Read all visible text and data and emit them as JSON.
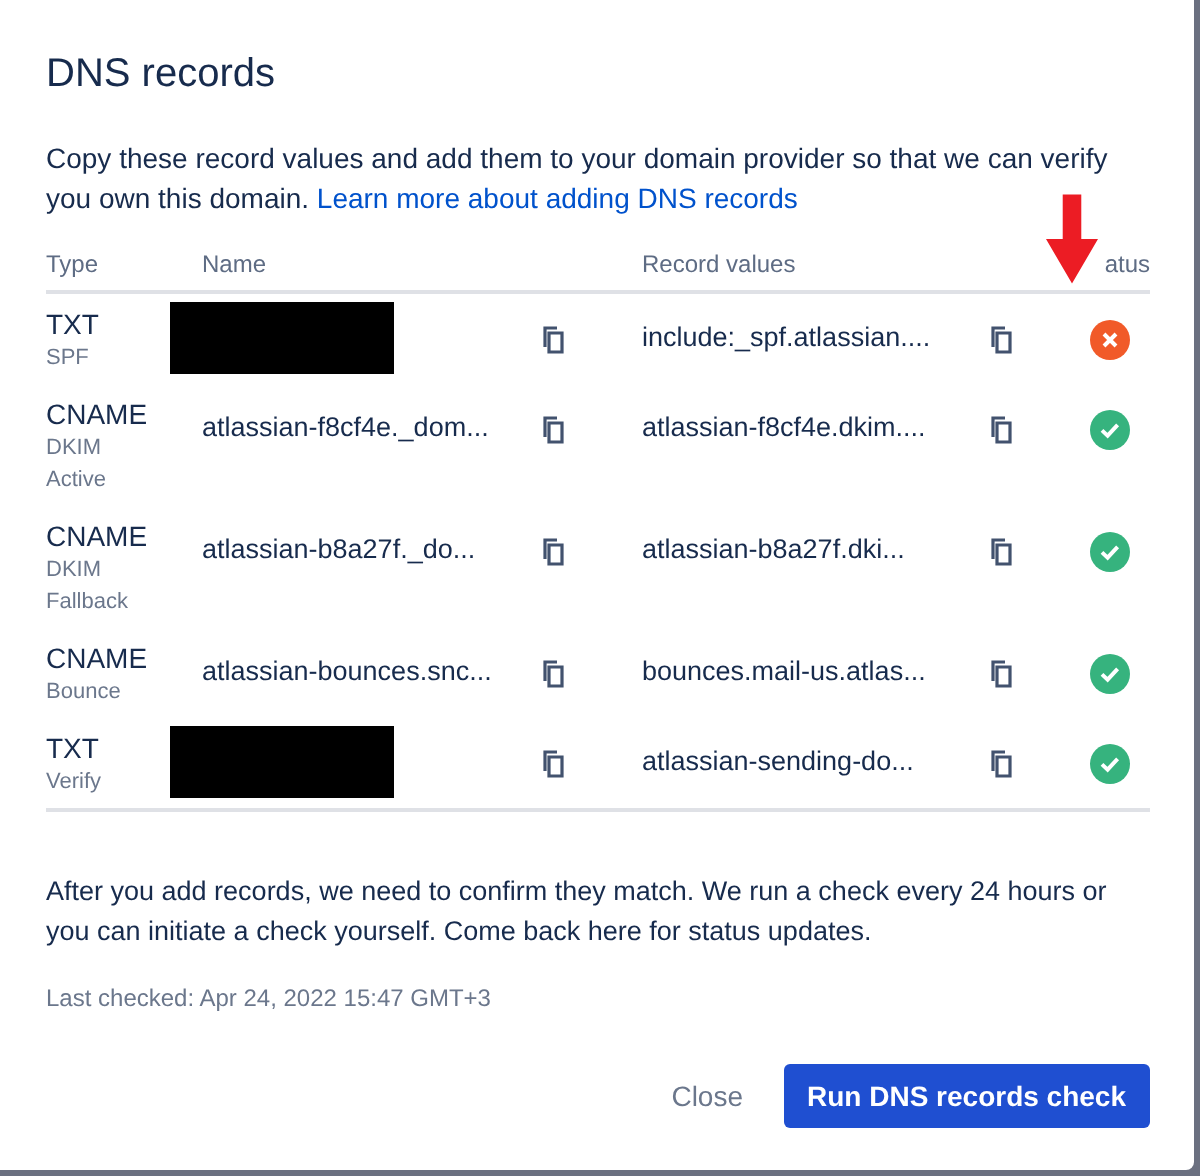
{
  "dialog": {
    "title": "DNS records",
    "description": "Copy these record values and add them to your domain provider so that we can verify you own this domain.",
    "description_link": "Learn more about adding DNS records"
  },
  "table": {
    "columns": [
      "Type",
      "Name",
      "Record values",
      "atus"
    ],
    "rows": [
      {
        "type": "TXT",
        "sublabels": [
          "SPF"
        ],
        "redacted": true,
        "value": "include:_spf.atlassian....",
        "verified": false
      },
      {
        "type": "CNAME",
        "sublabels": [
          "DKIM",
          "Active"
        ],
        "name": "atlassian-f8cf4e._dom...",
        "redacted": false,
        "value": "atlassian-f8cf4e.dkim....",
        "verified": true
      },
      {
        "type": "CNAME",
        "sublabels": [
          "DKIM",
          "Fallback"
        ],
        "name": "atlassian-b8a27f._do...",
        "redacted": false,
        "value": "atlassian-b8a27f.dki...",
        "verified": true
      },
      {
        "type": "CNAME",
        "sublabels": [
          "Bounce"
        ],
        "name": "atlassian-bounces.snc...",
        "redacted": false,
        "value": "bounces.mail-us.atlas...",
        "verified": true
      },
      {
        "type": "TXT",
        "sublabels": [
          "Verify"
        ],
        "redacted": true,
        "value": "atlassian-sending-do...",
        "verified": true
      }
    ]
  },
  "footer_text": "After you add records, we need to confirm they match. We run a check every 24 hours or you can initiate a check yourself. Come back here for status updates.",
  "last_checked": "Last checked: Apr 24, 2022 15:47 GMT+3",
  "buttons": [
    {
      "label": "Close",
      "kind": "subtle"
    },
    {
      "label": "Run DNS records check",
      "kind": "primary"
    }
  ],
  "annotation": {
    "kind": "arrow"
  }
}
